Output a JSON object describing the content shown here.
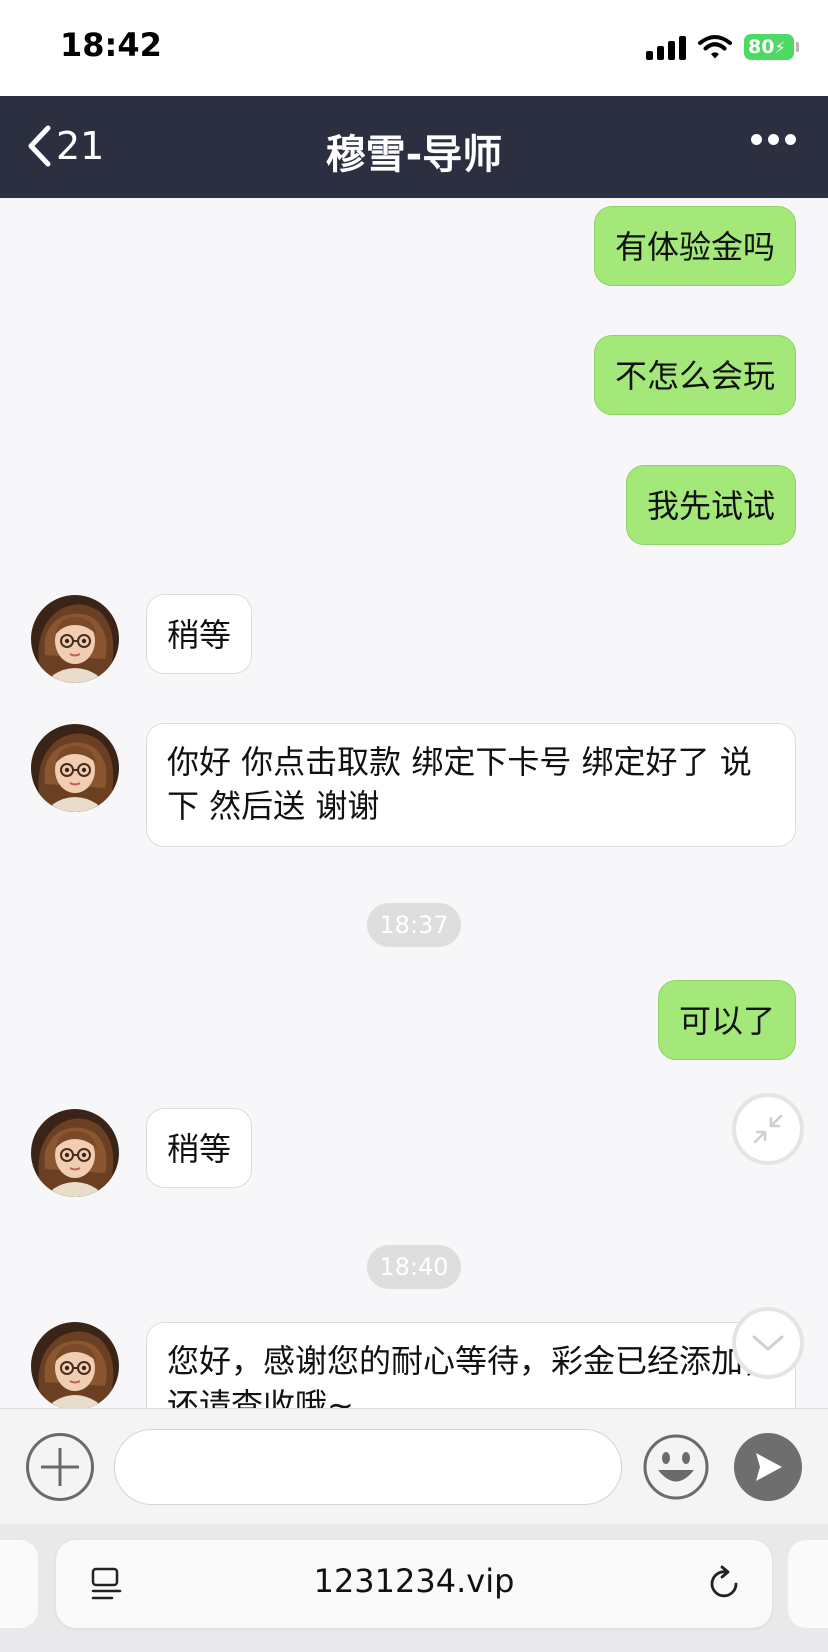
{
  "status_bar": {
    "time": "18:42",
    "battery": "80"
  },
  "header": {
    "back_count": "21",
    "title": "穆雪-导师"
  },
  "messages": [
    {
      "direction": "out",
      "text": "有体验金吗"
    },
    {
      "direction": "out",
      "text": "不怎么会玩"
    },
    {
      "direction": "out",
      "text": "我先试试"
    },
    {
      "direction": "in",
      "text": "稍等"
    },
    {
      "direction": "in",
      "text": "你好 你点击取款 绑定下卡号 绑定好了 说下 然后送 谢谢"
    },
    {
      "type": "time",
      "text": "18:37"
    },
    {
      "direction": "out",
      "text": "可以了"
    },
    {
      "direction": "in",
      "text": "稍等"
    },
    {
      "type": "time",
      "text": "18:40"
    },
    {
      "direction": "in",
      "text": "您好，感谢您的耐心等待，彩金已经添加，还请查收哦~"
    }
  ],
  "input": {
    "value": "",
    "placeholder": ""
  },
  "browser": {
    "url": "1231234.vip"
  },
  "colors": {
    "nav_bg": "#2b2f40",
    "outgoing_bubble": "#a3e878",
    "incoming_bubble": "#ffffff",
    "battery": "#4cd964"
  }
}
